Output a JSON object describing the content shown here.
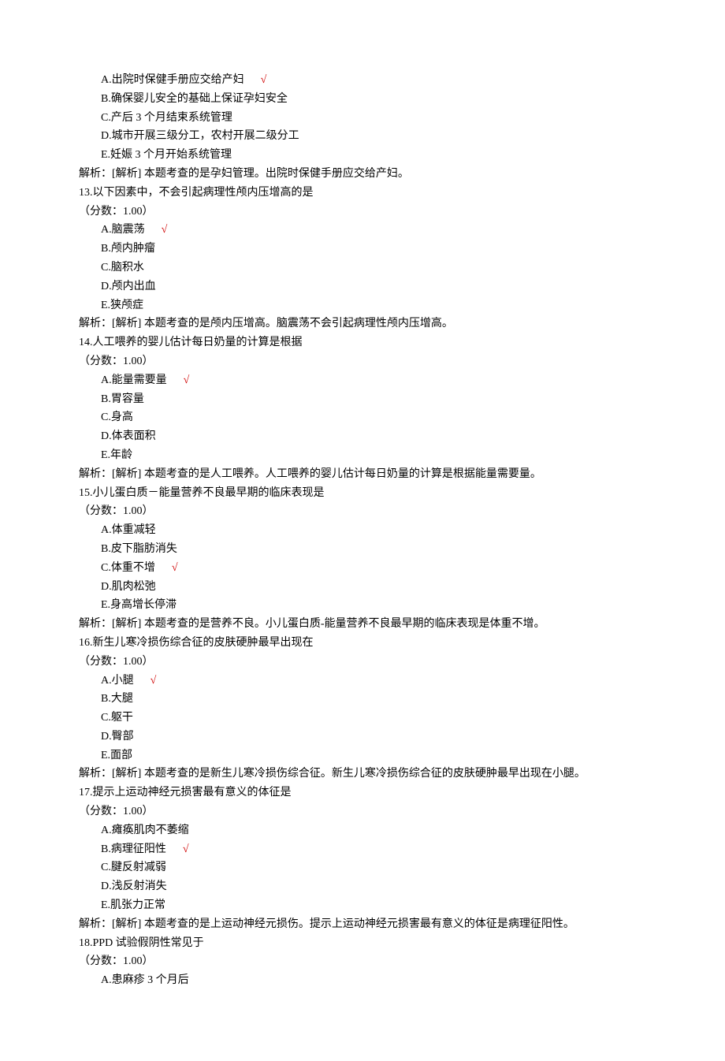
{
  "check": "√",
  "intro_options": [
    {
      "label": "A.出院时保健手册应交给产妇",
      "correct": true
    },
    {
      "label": "B.确保婴儿安全的基础上保证孕妇安全",
      "correct": false
    },
    {
      "label": "C.产后 3 个月结束系统管理",
      "correct": false
    },
    {
      "label": "D.城市开展三级分工，农村开展二级分工",
      "correct": false
    },
    {
      "label": "E.妊娠 3 个月开始系统管理",
      "correct": false
    }
  ],
  "intro_analysis": "解析：[解析] 本题考查的是孕妇管理。出院时保健手册应交给产妇。",
  "questions": [
    {
      "num": "13.",
      "stem": "以下因素中，不会引起病理性颅内压增高的是",
      "score": "（分数：1.00）",
      "options": [
        {
          "label": "A.脑震荡",
          "correct": true
        },
        {
          "label": "B.颅内肿瘤",
          "correct": false
        },
        {
          "label": "C.脑积水",
          "correct": false
        },
        {
          "label": "D.颅内出血",
          "correct": false
        },
        {
          "label": "E.狭颅症",
          "correct": false
        }
      ],
      "analysis": "解析：[解析] 本题考查的是颅内压增高。脑震荡不会引起病理性颅内压增高。"
    },
    {
      "num": "14.",
      "stem": "人工喂养的婴儿估计每日奶量的计算是根据",
      "score": "（分数：1.00）",
      "options": [
        {
          "label": "A.能量需要量",
          "correct": true
        },
        {
          "label": "B.胃容量",
          "correct": false
        },
        {
          "label": "C.身高",
          "correct": false
        },
        {
          "label": "D.体表面积",
          "correct": false
        },
        {
          "label": "E.年龄",
          "correct": false
        }
      ],
      "analysis": "解析：[解析] 本题考查的是人工喂养。人工喂养的婴儿估计每日奶量的计算是根据能量需要量。"
    },
    {
      "num": "15.",
      "stem": "小儿蛋白质－能量营养不良最早期的临床表现是",
      "score": "（分数：1.00）",
      "options": [
        {
          "label": "A.体重减轻",
          "correct": false
        },
        {
          "label": "B.皮下脂肪消失",
          "correct": false
        },
        {
          "label": "C.体重不增",
          "correct": true
        },
        {
          "label": "D.肌肉松弛",
          "correct": false
        },
        {
          "label": "E.身高增长停滞",
          "correct": false
        }
      ],
      "analysis": "解析：[解析] 本题考查的是营养不良。小儿蛋白质-能量营养不良最早期的临床表现是体重不增。"
    },
    {
      "num": "16.",
      "stem": "新生儿寒冷损伤综合征的皮肤硬肿最早出现在",
      "score": "（分数：1.00）",
      "options": [
        {
          "label": "A.小腿",
          "correct": true
        },
        {
          "label": "B.大腿",
          "correct": false
        },
        {
          "label": "C.躯干",
          "correct": false
        },
        {
          "label": "D.臀部",
          "correct": false
        },
        {
          "label": "E.面部",
          "correct": false
        }
      ],
      "analysis": "解析：[解析] 本题考查的是新生儿寒冷损伤综合征。新生儿寒冷损伤综合征的皮肤硬肿最早出现在小腿。"
    },
    {
      "num": "17.",
      "stem": "提示上运动神经元损害最有意义的体征是",
      "score": "（分数：1.00）",
      "options": [
        {
          "label": "A.瘫痪肌肉不萎缩",
          "correct": false
        },
        {
          "label": "B.病理征阳性",
          "correct": true
        },
        {
          "label": "C.腱反射减弱",
          "correct": false
        },
        {
          "label": "D.浅反射消失",
          "correct": false
        },
        {
          "label": "E.肌张力正常",
          "correct": false
        }
      ],
      "analysis": "解析：[解析] 本题考查的是上运动神经元损伤。提示上运动神经元损害最有意义的体征是病理征阳性。"
    },
    {
      "num": "18.",
      "stem": "PPD 试验假阴性常见于",
      "score": "（分数：1.00）",
      "options": [
        {
          "label": "A.患麻疹 3 个月后",
          "correct": false
        }
      ],
      "analysis": ""
    }
  ]
}
